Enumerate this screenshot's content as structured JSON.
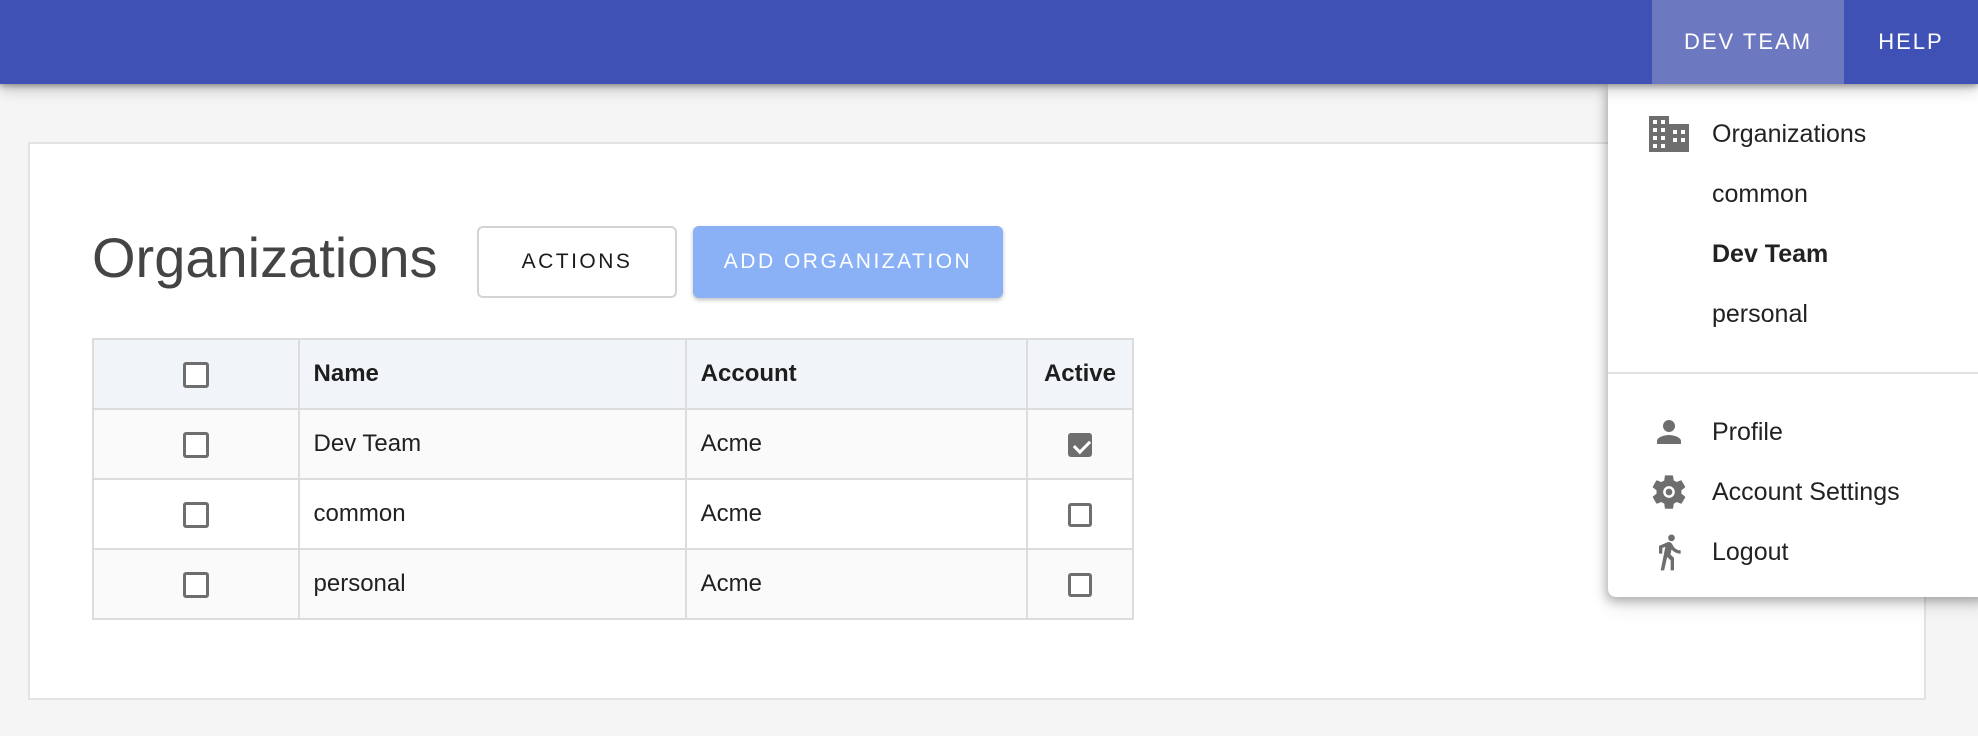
{
  "appbar": {
    "nav": [
      {
        "label": "DEV TEAM",
        "active": true
      },
      {
        "label": "HELP",
        "active": false
      }
    ],
    "color": "#3f51b5"
  },
  "main": {
    "title": "Organizations",
    "actions_label": "ACTIONS",
    "add_label": "ADD ORGANIZATION",
    "table": {
      "columns": [
        "",
        "Name",
        "Account",
        "Active"
      ],
      "rows": [
        {
          "name": "Dev Team",
          "account": "Acme",
          "selected": false,
          "active": true
        },
        {
          "name": "common",
          "account": "Acme",
          "selected": false,
          "active": false
        },
        {
          "name": "personal",
          "account": "Acme",
          "selected": false,
          "active": false
        }
      ]
    }
  },
  "menu": {
    "organizations_heading": {
      "label": "Organizations",
      "icon": "building-icon"
    },
    "organizations": [
      {
        "label": "common",
        "current": false
      },
      {
        "label": "Dev Team",
        "current": true
      },
      {
        "label": "personal",
        "current": false
      }
    ],
    "account_items": [
      {
        "label": "Profile",
        "icon": "person-icon"
      },
      {
        "label": "Account Settings",
        "icon": "gear-icon"
      },
      {
        "label": "Logout",
        "icon": "running-person-icon"
      }
    ]
  }
}
